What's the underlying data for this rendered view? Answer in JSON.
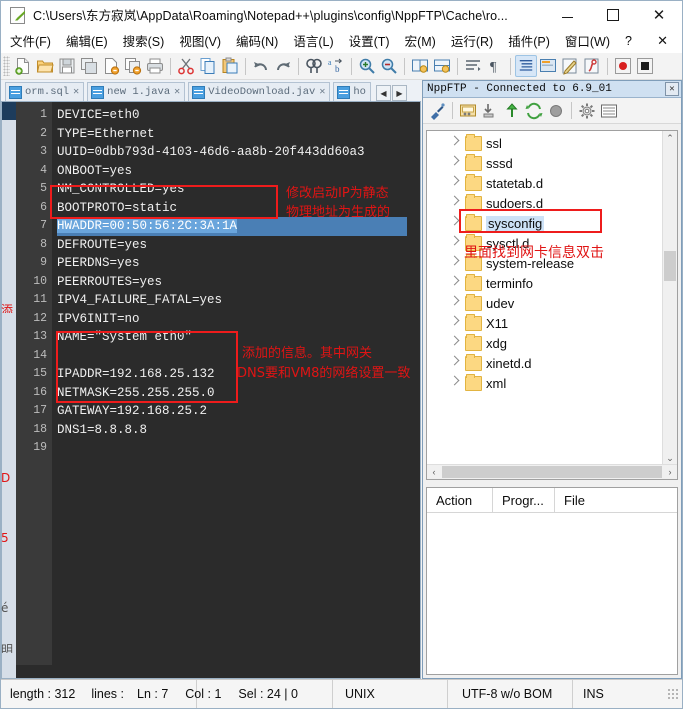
{
  "window": {
    "title": "C:\\Users\\东方寂岚\\AppData\\Roaming\\Notepad++\\plugins\\config\\NppFTP\\Cache\\ro...",
    "minimize": "—",
    "maximize": "□",
    "close": "✕"
  },
  "menubar": {
    "items": [
      "文件(F)",
      "编辑(E)",
      "搜索(S)",
      "视图(V)",
      "编码(N)",
      "语言(L)",
      "设置(T)",
      "宏(M)",
      "运行(R)",
      "插件(P)",
      "窗口(W)",
      "?"
    ],
    "close_doc": "✕"
  },
  "toolbar": {
    "icons": [
      "new-file-icon",
      "open-file-icon",
      "save-icon",
      "save-all-icon",
      "close-file-icon",
      "close-all-icon",
      "print-icon",
      "cut-icon",
      "copy-icon",
      "paste-icon",
      "undo-icon",
      "redo-icon",
      "find-icon",
      "replace-icon",
      "zoom-in-icon",
      "zoom-out-icon",
      "sync-v-icon",
      "sync-h-icon",
      "word-wrap-icon",
      "show-all-chars-icon",
      "indent-guide-icon",
      "ui-display-icon",
      "user-defined-lang-icon",
      "function-list-icon",
      "record-macro-icon",
      "stop-macro-icon"
    ]
  },
  "tabs": {
    "items": [
      {
        "label": "orm.sql",
        "close": "✕"
      },
      {
        "label": "new 1.java",
        "close": "✕"
      },
      {
        "label": "VideoDownload.jav",
        "close": "✕"
      },
      {
        "label": "ho",
        "close": ""
      }
    ],
    "nav_left": "◀",
    "nav_right": "▶"
  },
  "editor": {
    "lines": [
      {
        "n": "1",
        "text": "DEVICE=eth0"
      },
      {
        "n": "2",
        "text": "TYPE=Ethernet"
      },
      {
        "n": "3",
        "text": "UUID=0dbb793d-4103-46d6-aa8b-20f443dd60a3"
      },
      {
        "n": "4",
        "text": "ONBOOT=yes"
      },
      {
        "n": "5",
        "text": "NM_CONTROLLED=yes"
      },
      {
        "n": "6",
        "text": "BOOTPROTO=static"
      },
      {
        "n": "7",
        "text": "HWADDR=00:50:56:2C:3A:1A",
        "selected": true
      },
      {
        "n": "8",
        "text": "DEFROUTE=yes"
      },
      {
        "n": "9",
        "text": "PEERDNS=yes"
      },
      {
        "n": "10",
        "text": "PEERROUTES=yes"
      },
      {
        "n": "11",
        "text": "IPV4_FAILURE_FATAL=yes"
      },
      {
        "n": "12",
        "text": "IPV6INIT=no"
      },
      {
        "n": "13",
        "text": "NAME=\"System eth0\""
      },
      {
        "n": "14",
        "text": ""
      },
      {
        "n": "15",
        "text": "IPADDR=192.168.25.132"
      },
      {
        "n": "16",
        "text": "NETMASK=255.255.255.0"
      },
      {
        "n": "17",
        "text": "GATEWAY=192.168.25.2"
      },
      {
        "n": "18",
        "text": "DNS1=8.8.8.8"
      },
      {
        "n": "19",
        "text": ""
      }
    ],
    "annotations": [
      {
        "text": "修改启动IP为静态",
        "color": "#e01414"
      },
      {
        "text": "物理地址为生成的",
        "color": "#e01414"
      },
      {
        "text": "添加的信息。其中网关",
        "color": "#e01414"
      },
      {
        "text": "DNS要和VM8的网络设置一致",
        "color": "#e01414"
      }
    ]
  },
  "ftp": {
    "title": "NppFTP - Connected to 6.9_01",
    "close": "✕",
    "tools": [
      "connect-icon",
      "open-dir-icon",
      "download-icon",
      "upload-icon",
      "refresh-icon",
      "abort-icon",
      "settings-icon",
      "messages-icon"
    ],
    "tree": [
      {
        "label": "ssl"
      },
      {
        "label": "sssd"
      },
      {
        "label": "statetab.d"
      },
      {
        "label": "sudoers.d"
      },
      {
        "label": "sysconfig",
        "selected": true
      },
      {
        "label": "sysctl.d"
      },
      {
        "label": "system-release"
      },
      {
        "label": "terminfo"
      },
      {
        "label": "udev"
      },
      {
        "label": "X11"
      },
      {
        "label": "xdg"
      },
      {
        "label": "xinetd.d"
      },
      {
        "label": "xml"
      }
    ],
    "tree_annotation": "里面找到网卡信息双击",
    "scroll_up": "⌃",
    "scroll_down": "⌄",
    "scroll_left": "‹",
    "scroll_right": "›",
    "queue_columns": [
      "Action",
      "Progr...",
      "File"
    ]
  },
  "statusbar": {
    "length": "length : 312",
    "lines": "lines : ",
    "ln": "Ln : 7",
    "col": "Col : 1",
    "sel": "Sel : 24 | 0",
    "eol": "UNIX",
    "encoding": "UTF-8 w/o BOM",
    "mode": "INS"
  },
  "colors": {
    "annotation_red": "#e01414",
    "selection_blue": "#4a7fb5",
    "editor_bg": "#2b2b2b",
    "tree_select": "#cde2f7"
  }
}
